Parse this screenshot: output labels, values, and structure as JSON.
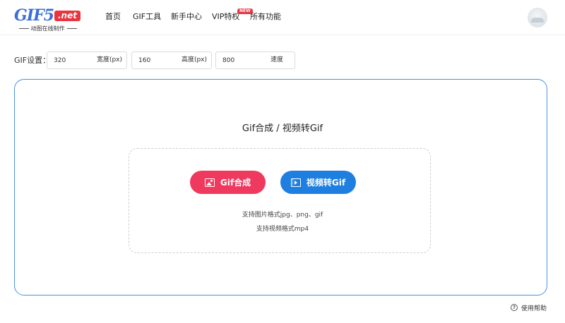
{
  "logo": {
    "main": "GIF5",
    "net": ".net",
    "tagline": "动图在线制作"
  },
  "nav": {
    "home": "首页",
    "gif_tools": "GIF工具",
    "beginner_center": "新手中心",
    "vip": "VIP特权",
    "vip_badge": "NEW",
    "all_features": "所有功能"
  },
  "settings": {
    "label": "GIF设置：",
    "width": {
      "value": "320",
      "unit": "宽度(px)"
    },
    "height": {
      "value": "160",
      "unit": "高度(px)"
    },
    "speed": {
      "value": "800",
      "unit": "速度"
    }
  },
  "panel": {
    "title": "Gif合成 / 视频转Gif",
    "gif_button": "Gif合成",
    "video_button": "视频转Gif",
    "support_image": "支持图片格式jpg、png、gif",
    "support_video": "支持视频格式mp4"
  },
  "help": {
    "label": "使用帮助"
  },
  "colors": {
    "accent_blue": "#1e7fe0",
    "accent_pink": "#f0395e",
    "panel_border": "#4a90e2",
    "badge_red": "#e8353f"
  }
}
